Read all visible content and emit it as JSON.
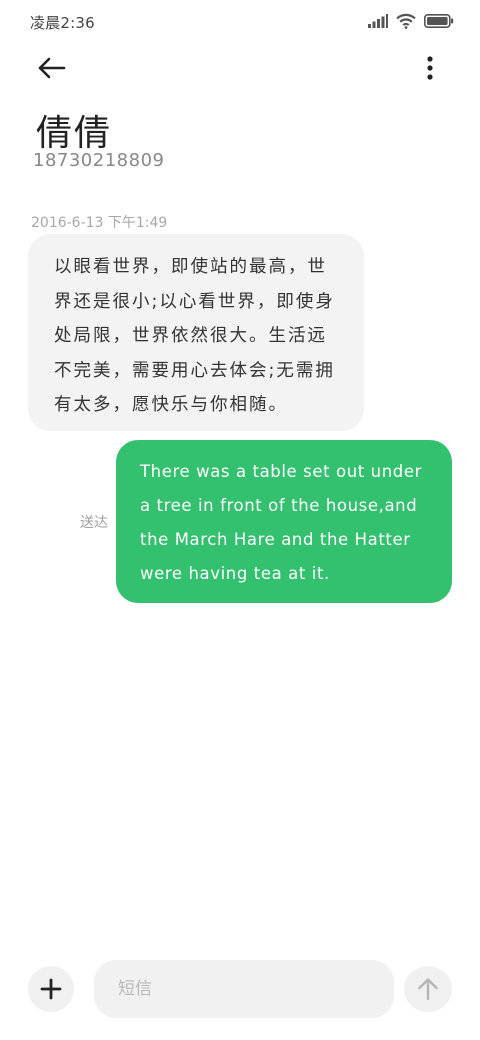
{
  "status_bar": {
    "time": "凌晨2:36",
    "icons": [
      "signal-icon",
      "wifi-icon",
      "battery-icon"
    ]
  },
  "header": {
    "back_icon": "arrow-left-icon",
    "more_icon": "more-vertical-icon",
    "contact_name": "倩倩",
    "contact_number": "18730218809"
  },
  "conversation": {
    "timestamp": "2016-6-13  下午1:49",
    "messages": [
      {
        "direction": "incoming",
        "text": "以眼看世界，即使站的最高，世界还是很小;以心看世界，即使身处局限，世界依然很大。生活远不完美，需要用心去体会;无需拥有太多，愿快乐与你相随。"
      },
      {
        "direction": "outgoing",
        "text": "There was a table set out under a tree in front of the house,and the March Hare and the Hatter were having tea at it.",
        "status": "送达"
      }
    ]
  },
  "composer": {
    "add_icon": "plus-icon",
    "placeholder": "短信",
    "value": "",
    "send_icon": "arrow-up-icon"
  },
  "colors": {
    "outgoing_bubble": "#33c06f",
    "incoming_bubble": "#f3f3f3",
    "background": "#ffffff"
  }
}
